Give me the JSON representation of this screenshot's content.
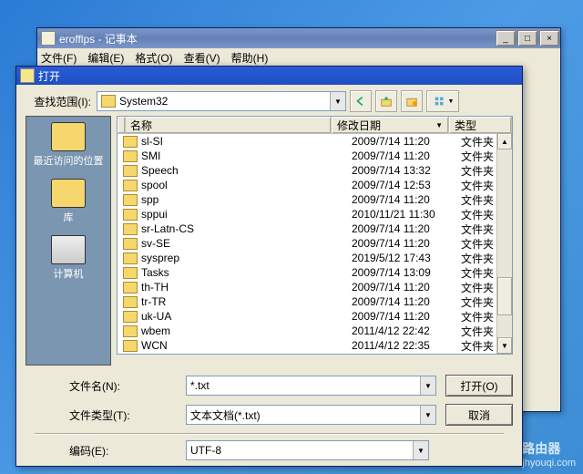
{
  "notepad": {
    "title": "erofflps - 记事本",
    "menu": {
      "file": "文件(F)",
      "edit": "编辑(E)",
      "format": "格式(O)",
      "view": "查看(V)",
      "help": "帮助(H)"
    }
  },
  "dialog": {
    "title": "打开",
    "look_in_label": "查找范围(I):",
    "look_in_value": "System32",
    "columns": {
      "name": "名称",
      "date": "修改日期",
      "type": "类型",
      "sort_arrow": "▼"
    },
    "folder_type": "文件夹",
    "files": [
      {
        "name": "sl-SI",
        "date": "2009/7/14 11:20"
      },
      {
        "name": "SMI",
        "date": "2009/7/14 11:20"
      },
      {
        "name": "Speech",
        "date": "2009/7/14 13:32"
      },
      {
        "name": "spool",
        "date": "2009/7/14 12:53"
      },
      {
        "name": "spp",
        "date": "2009/7/14 11:20"
      },
      {
        "name": "sppui",
        "date": "2010/11/21 11:30"
      },
      {
        "name": "sr-Latn-CS",
        "date": "2009/7/14 11:20"
      },
      {
        "name": "sv-SE",
        "date": "2009/7/14 11:20"
      },
      {
        "name": "sysprep",
        "date": "2019/5/12 17:43"
      },
      {
        "name": "Tasks",
        "date": "2009/7/14 13:09"
      },
      {
        "name": "th-TH",
        "date": "2009/7/14 11:20"
      },
      {
        "name": "tr-TR",
        "date": "2009/7/14 11:20"
      },
      {
        "name": "uk-UA",
        "date": "2009/7/14 11:20"
      },
      {
        "name": "wbem",
        "date": "2011/4/12 22:42"
      },
      {
        "name": "WCN",
        "date": "2011/4/12 22:35"
      }
    ],
    "places": {
      "recent": "最近访问的位置",
      "library": "库",
      "computer": "计算机"
    },
    "filename_label": "文件名(N):",
    "filename_value": "*.txt",
    "filetype_label": "文件类型(T):",
    "filetype_value": "文本文档(*.txt)",
    "encoding_label": "编码(E):",
    "encoding_value": "UTF-8",
    "open_btn": "打开(O)",
    "cancel_btn": "取消"
  },
  "watermark": {
    "brand": "路由器",
    "site": "jhyouqi.com"
  }
}
